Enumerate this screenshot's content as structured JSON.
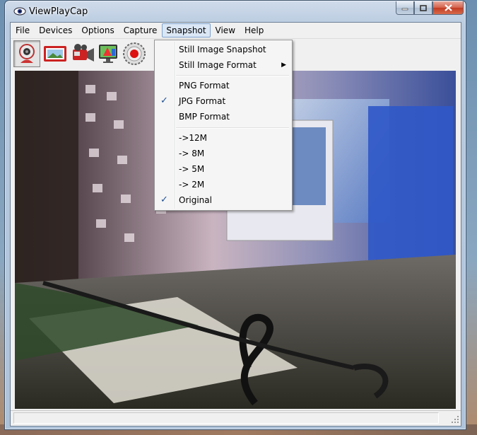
{
  "window": {
    "title": "ViewPlayCap"
  },
  "menubar": {
    "items": [
      "File",
      "Devices",
      "Options",
      "Capture",
      "Snapshot",
      "View",
      "Help"
    ]
  },
  "toolbar": {
    "buttons": [
      "webcam-icon",
      "photo-icon",
      "camcorder-icon",
      "monitor-icon",
      "record-icon"
    ]
  },
  "snapshot_menu": {
    "still_snapshot": "Still Image Snapshot",
    "still_format": "Still Image Format",
    "png": "PNG Format",
    "jpg": "JPG Format",
    "bmp": "BMP Format",
    "res_12m": "->12M",
    "res_8m": "-> 8M",
    "res_5m": "-> 5M",
    "res_2m": "-> 2M",
    "original": "Original",
    "check_mark": "✓",
    "submenu_arrow": "▶"
  },
  "status": {
    "text": ""
  },
  "colors": {
    "accent": "#1e4f93",
    "titlebar": "#b9cbe0",
    "close": "#c23b22"
  }
}
